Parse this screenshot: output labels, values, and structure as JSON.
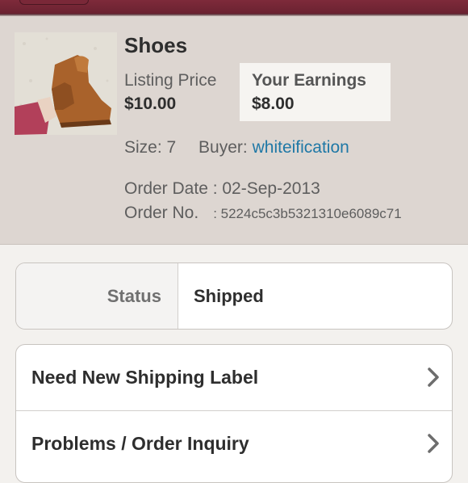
{
  "listing": {
    "title": "Shoes",
    "image_icon": "product-photo-suede-fringe-boot",
    "listing_price_label": "Listing Price",
    "listing_price": "$10.00",
    "earnings_label": "Your Earnings",
    "earnings": "$8.00",
    "size_label": "Size: 7",
    "buyer_label": "Buyer:",
    "buyer_name": "whiteification",
    "order_date_label": "Order Date : 02-Sep-2013",
    "order_no_label": "Order No.",
    "order_no": ": 5224c5c3b5321310e6089c71"
  },
  "status": {
    "label": "Status",
    "value": "Shipped"
  },
  "actions": [
    {
      "label": "Need New Shipping Label",
      "icon": "chevron-right-icon"
    },
    {
      "label": "Problems / Order Inquiry",
      "icon": "chevron-right-icon"
    }
  ],
  "colors": {
    "header": "#7e2a3a",
    "summary_bg": "#ddd6d1",
    "link": "#1f78a6"
  }
}
